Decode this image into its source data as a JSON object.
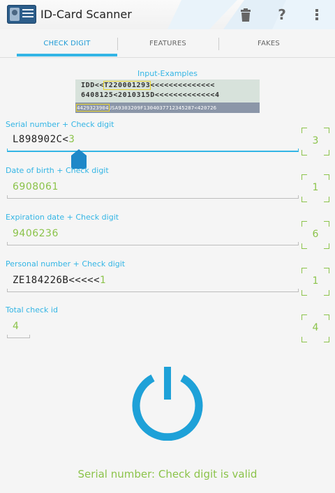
{
  "app": {
    "title": "ID-Card Scanner"
  },
  "actions": {
    "delete_icon": "trash-icon",
    "help_label": "?",
    "overflow_icon": "overflow-menu-icon"
  },
  "tabs": [
    {
      "label": "CHECK DIGIT",
      "active": true
    },
    {
      "label": "FEATURES",
      "active": false
    },
    {
      "label": "FAKES",
      "active": false
    }
  ],
  "examples": {
    "label": "Input-Examples",
    "mrz_line1_a": "IDD<<",
    "mrz_line1_b": "T220001293",
    "mrz_line1_c": "<<<<<<<<<<<<<<",
    "mrz_line2": "6408125<2010315D<<<<<<<<<<<<<4",
    "mrz_line3_a": "4429323904",
    "mrz_line3_b": "USA9303209F1304037712345287<420726"
  },
  "fields": {
    "serial": {
      "label": "Serial number + Check digit",
      "value_main": "L898902C<",
      "value_check": "3",
      "check_digit": "3"
    },
    "dob": {
      "label": "Date of birth + Check digit",
      "value": "6908061",
      "check_digit": "1"
    },
    "expiry": {
      "label": "Expiration date + Check digit",
      "value": "9406236",
      "check_digit": "6"
    },
    "personal": {
      "label": "Personal number + Check digit",
      "value_main": "ZE184226B<<<<<",
      "value_check": "1",
      "check_digit": "1"
    },
    "total": {
      "label": "Total check id",
      "value": "4",
      "check_digit": "4"
    }
  },
  "status": {
    "message": "Serial number: Check digit is valid"
  },
  "colors": {
    "accent": "#33b5e5",
    "valid": "#8bc34a",
    "power": "#1ea1d8"
  }
}
